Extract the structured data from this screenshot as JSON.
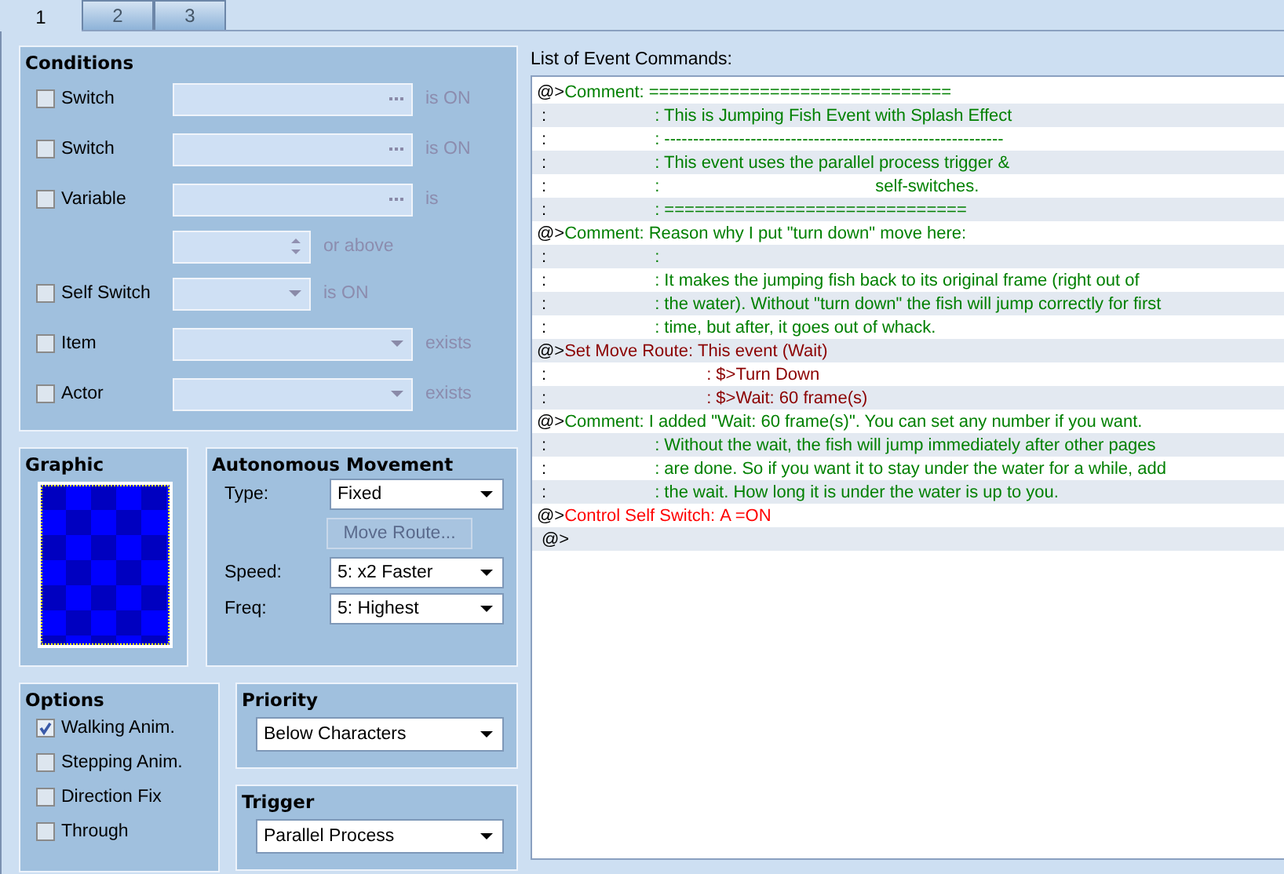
{
  "tabs": [
    {
      "label": "1",
      "selected": true
    },
    {
      "label": "2",
      "selected": false
    },
    {
      "label": "3",
      "selected": false
    }
  ],
  "conditions": {
    "title": "Conditions",
    "rows": [
      {
        "kind": "picker",
        "label": "Switch",
        "checked": false,
        "suffix": "is ON"
      },
      {
        "kind": "picker",
        "label": "Switch",
        "checked": false,
        "suffix": "is ON"
      },
      {
        "kind": "picker",
        "label": "Variable",
        "checked": false,
        "suffix": "is"
      },
      {
        "kind": "spin",
        "suffix": "or above"
      },
      {
        "kind": "short_select",
        "label": "Self Switch",
        "checked": false,
        "suffix": "is ON"
      },
      {
        "kind": "select",
        "label": "Item",
        "checked": false,
        "suffix": "exists"
      },
      {
        "kind": "select",
        "label": "Actor",
        "checked": false,
        "suffix": "exists"
      }
    ]
  },
  "graphic": {
    "title": "Graphic"
  },
  "movement": {
    "title": "Autonomous Movement",
    "type": {
      "label": "Type:",
      "value": "Fixed"
    },
    "route_button": {
      "label": "Move Route...",
      "disabled": true
    },
    "speed": {
      "label": "Speed:",
      "value": "5: x2 Faster"
    },
    "freq": {
      "label": "Freq:",
      "value": "5: Highest"
    }
  },
  "options": {
    "title": "Options",
    "items": [
      {
        "label": "Walking Anim.",
        "checked": true
      },
      {
        "label": "Stepping Anim.",
        "checked": false
      },
      {
        "label": "Direction Fix",
        "checked": false
      },
      {
        "label": "Through",
        "checked": false
      }
    ]
  },
  "priority": {
    "title": "Priority",
    "value": "Below Characters"
  },
  "trigger": {
    "title": "Trigger",
    "value": "Parallel Process"
  },
  "commands": {
    "title": "List of Event Commands:",
    "lines": [
      {
        "kind": "comment",
        "marker": "@>",
        "label": "Comment:",
        "text": "=============================="
      },
      {
        "kind": "comment",
        "marker": ":",
        "text": ": This is Jumping Fish Event with Splash Effect"
      },
      {
        "kind": "comment",
        "marker": ":",
        "text": ": -----------------------------------------------------------"
      },
      {
        "kind": "comment",
        "marker": ":",
        "text": ": This event uses the parallel process trigger &"
      },
      {
        "kind": "comment",
        "marker": ":",
        "text": ":                                             self-switches."
      },
      {
        "kind": "comment",
        "marker": ":",
        "text": ": =============================="
      },
      {
        "kind": "comment",
        "marker": "@>",
        "label": "Comment:",
        "text": "Reason why I put \"turn down\" move here:"
      },
      {
        "kind": "comment",
        "marker": ":",
        "text": ":"
      },
      {
        "kind": "comment",
        "marker": ":",
        "text": ": It makes the jumping fish back to its original frame (right out of"
      },
      {
        "kind": "comment",
        "marker": ":",
        "text": ": the water). Without \"turn down\" the fish will jump correctly for first"
      },
      {
        "kind": "comment",
        "marker": ":",
        "text": ": time, but after, it goes out of whack."
      },
      {
        "kind": "move",
        "marker": "@>",
        "label": "Set Move Route:",
        "text": "This event (Wait)"
      },
      {
        "kind": "move",
        "marker": ":",
        "text": ": $>Turn Down"
      },
      {
        "kind": "move",
        "marker": ":",
        "text": ": $>Wait: 60 frame(s)"
      },
      {
        "kind": "comment",
        "marker": "@>",
        "label": "Comment:",
        "text": "I added \"Wait: 60 frame(s)\". You can set any number if you want."
      },
      {
        "kind": "comment",
        "marker": ":",
        "text": ": Without the wait, the fish will jump immediately after other pages"
      },
      {
        "kind": "comment",
        "marker": ":",
        "text": ": are done. So if you want it to stay under the water for a while, add"
      },
      {
        "kind": "comment",
        "marker": ":",
        "text": ": the wait. How long it is under the water is up to you."
      },
      {
        "kind": "control",
        "marker": "@>",
        "label": "Control Self Switch:",
        "text": "A =ON"
      },
      {
        "marker": "@>"
      }
    ]
  }
}
